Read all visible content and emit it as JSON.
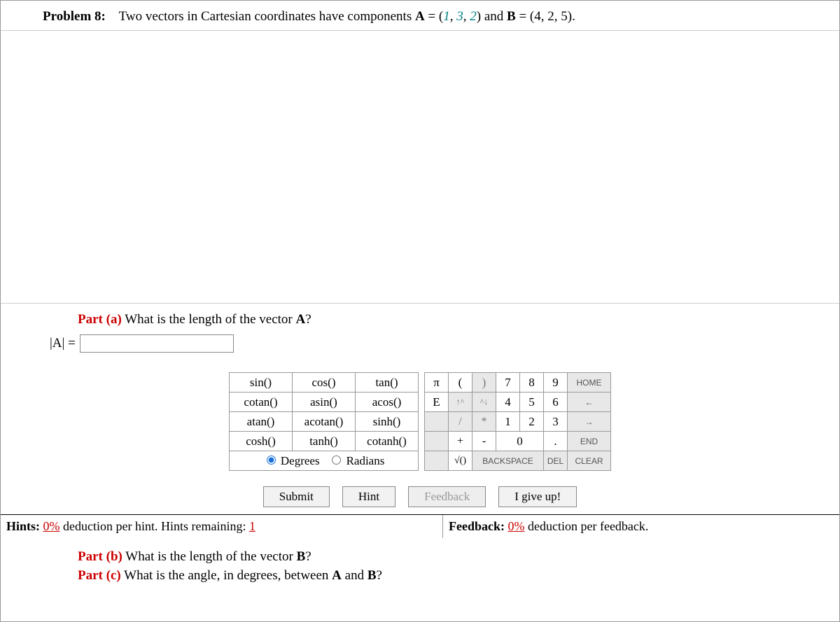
{
  "problem": {
    "label": "Problem 8:",
    "text_prefix": "Two vectors in Cartesian coordinates have components ",
    "vecA": "A",
    "eqA": " = (",
    "A1": "1",
    "A_sep1": ", ",
    "A2": "3",
    "A_sep2": ", ",
    "A3": "2",
    "Aclose": ") and ",
    "vecB": "B",
    "eqB": " = (4, 2, 5)."
  },
  "partA": {
    "label": "Part (a)",
    "question": "  What is the length of the vector ",
    "vec": "A",
    "qend": "?",
    "lhs": "|A| = "
  },
  "funcpad": {
    "r1c1": "sin()",
    "r1c2": "cos()",
    "r1c3": "tan()",
    "r2c1": "cotan()",
    "r2c2": "asin()",
    "r2c3": "acos()",
    "r3c1": "atan()",
    "r3c2": "acotan()",
    "r3c3": "sinh()",
    "r4c1": "cosh()",
    "r4c2": "tanh()",
    "r4c3": "cotanh()",
    "deg": "Degrees",
    "rad": "Radians"
  },
  "numpad": {
    "pi": "π",
    "lp": "(",
    "rp": ")",
    "k7": "7",
    "k8": "8",
    "k9": "9",
    "home": "HOME",
    "E": "E",
    "up": "↑^",
    "down": "^↓",
    "k4": "4",
    "k5": "5",
    "k6": "6",
    "larr": "←",
    "slash": "/",
    "star": "*",
    "k1": "1",
    "k2": "2",
    "k3": "3",
    "rarr": "→",
    "plus": "+",
    "minus": "-",
    "k0": "0",
    "dot": ".",
    "end": "END",
    "sqrt": "√()",
    "bksp": "BACKSPACE",
    "del": "DEL",
    "clear": "CLEAR"
  },
  "actions": {
    "submit": "Submit",
    "hint": "Hint",
    "feedback": "Feedback",
    "giveup": "I give up!"
  },
  "deduct": {
    "hints_prefix": "Hints: ",
    "hints_pct": "0%",
    "hints_mid": "  deduction per hint. Hints remaining: ",
    "hints_remain": "1",
    "fb_prefix": "Feedback: ",
    "fb_pct": "0%",
    "fb_suffix": "  deduction per feedback."
  },
  "partB": {
    "label": "Part (b)",
    "question": "  What is the length of the vector ",
    "vec": "B",
    "qend": "?"
  },
  "partC": {
    "label": "Part (c)",
    "question": "  What is the angle, in degrees, between ",
    "vecA": "A",
    "mid": " and ",
    "vecB": "B",
    "qend": "?"
  }
}
